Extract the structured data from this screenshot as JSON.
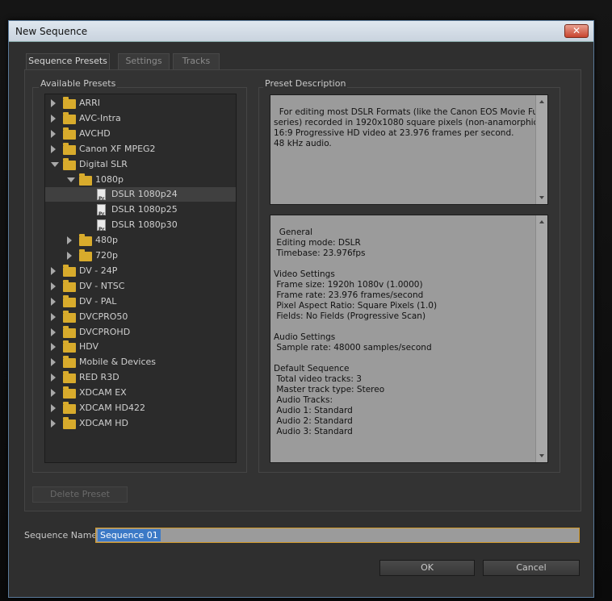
{
  "window": {
    "title": "New Sequence",
    "close_glyph": "✕"
  },
  "tabs": [
    {
      "label": "Sequence Presets",
      "active": true
    },
    {
      "label": "Settings",
      "active": false
    },
    {
      "label": "Tracks",
      "active": false
    }
  ],
  "presets": {
    "group_label": "Available Presets",
    "items": [
      {
        "label": "ARRI",
        "type": "folder",
        "depth": 0,
        "expanded": false
      },
      {
        "label": "AVC-Intra",
        "type": "folder",
        "depth": 0,
        "expanded": false
      },
      {
        "label": "AVCHD",
        "type": "folder",
        "depth": 0,
        "expanded": false
      },
      {
        "label": "Canon XF MPEG2",
        "type": "folder",
        "depth": 0,
        "expanded": false
      },
      {
        "label": "Digital SLR",
        "type": "folder",
        "depth": 0,
        "expanded": true
      },
      {
        "label": "1080p",
        "type": "folder",
        "depth": 1,
        "expanded": true
      },
      {
        "label": "DSLR 1080p24",
        "type": "file",
        "depth": 2,
        "selected": true
      },
      {
        "label": "DSLR 1080p25",
        "type": "file",
        "depth": 2
      },
      {
        "label": "DSLR 1080p30",
        "type": "file",
        "depth": 2
      },
      {
        "label": "480p",
        "type": "folder",
        "depth": 1,
        "expanded": false
      },
      {
        "label": "720p",
        "type": "folder",
        "depth": 1,
        "expanded": false
      },
      {
        "label": "DV - 24P",
        "type": "folder",
        "depth": 0,
        "expanded": false
      },
      {
        "label": "DV - NTSC",
        "type": "folder",
        "depth": 0,
        "expanded": false
      },
      {
        "label": "DV - PAL",
        "type": "folder",
        "depth": 0,
        "expanded": false
      },
      {
        "label": "DVCPRO50",
        "type": "folder",
        "depth": 0,
        "expanded": false
      },
      {
        "label": "DVCPROHD",
        "type": "folder",
        "depth": 0,
        "expanded": false
      },
      {
        "label": "HDV",
        "type": "folder",
        "depth": 0,
        "expanded": false
      },
      {
        "label": "Mobile & Devices",
        "type": "folder",
        "depth": 0,
        "expanded": false
      },
      {
        "label": "RED R3D",
        "type": "folder",
        "depth": 0,
        "expanded": false
      },
      {
        "label": "XDCAM EX",
        "type": "folder",
        "depth": 0,
        "expanded": false
      },
      {
        "label": "XDCAM HD422",
        "type": "folder",
        "depth": 0,
        "expanded": false
      },
      {
        "label": "XDCAM HD",
        "type": "folder",
        "depth": 0,
        "expanded": false
      }
    ],
    "file_icon_text": "Pr",
    "delete_button": "Delete Preset"
  },
  "description": {
    "group_label": "Preset Description",
    "text": "For editing most DSLR Formats (like the Canon EOS Movie Full HD\nseries) recorded in 1920x1080 square pixels (non-anamorphic).\n16:9 Progressive HD video at 23.976 frames per second.\n48 kHz audio.",
    "details": "General\n Editing mode: DSLR\n Timebase: 23.976fps\n\nVideo Settings\n Frame size: 1920h 1080v (1.0000)\n Frame rate: 23.976 frames/second\n Pixel Aspect Ratio: Square Pixels (1.0)\n Fields: No Fields (Progressive Scan)\n\nAudio Settings\n Sample rate: 48000 samples/second\n\nDefault Sequence\n Total video tracks: 3\n Master track type: Stereo\n Audio Tracks:\n Audio 1: Standard\n Audio 2: Standard\n Audio 3: Standard"
  },
  "sequence_name": {
    "label": "Sequence Name:",
    "value": "Sequence 01"
  },
  "buttons": {
    "ok": "OK",
    "cancel": "Cancel"
  },
  "colors": {
    "folder": "#d8ab2c",
    "selection": "#3b79c6",
    "focus_border": "#d29a2a"
  }
}
